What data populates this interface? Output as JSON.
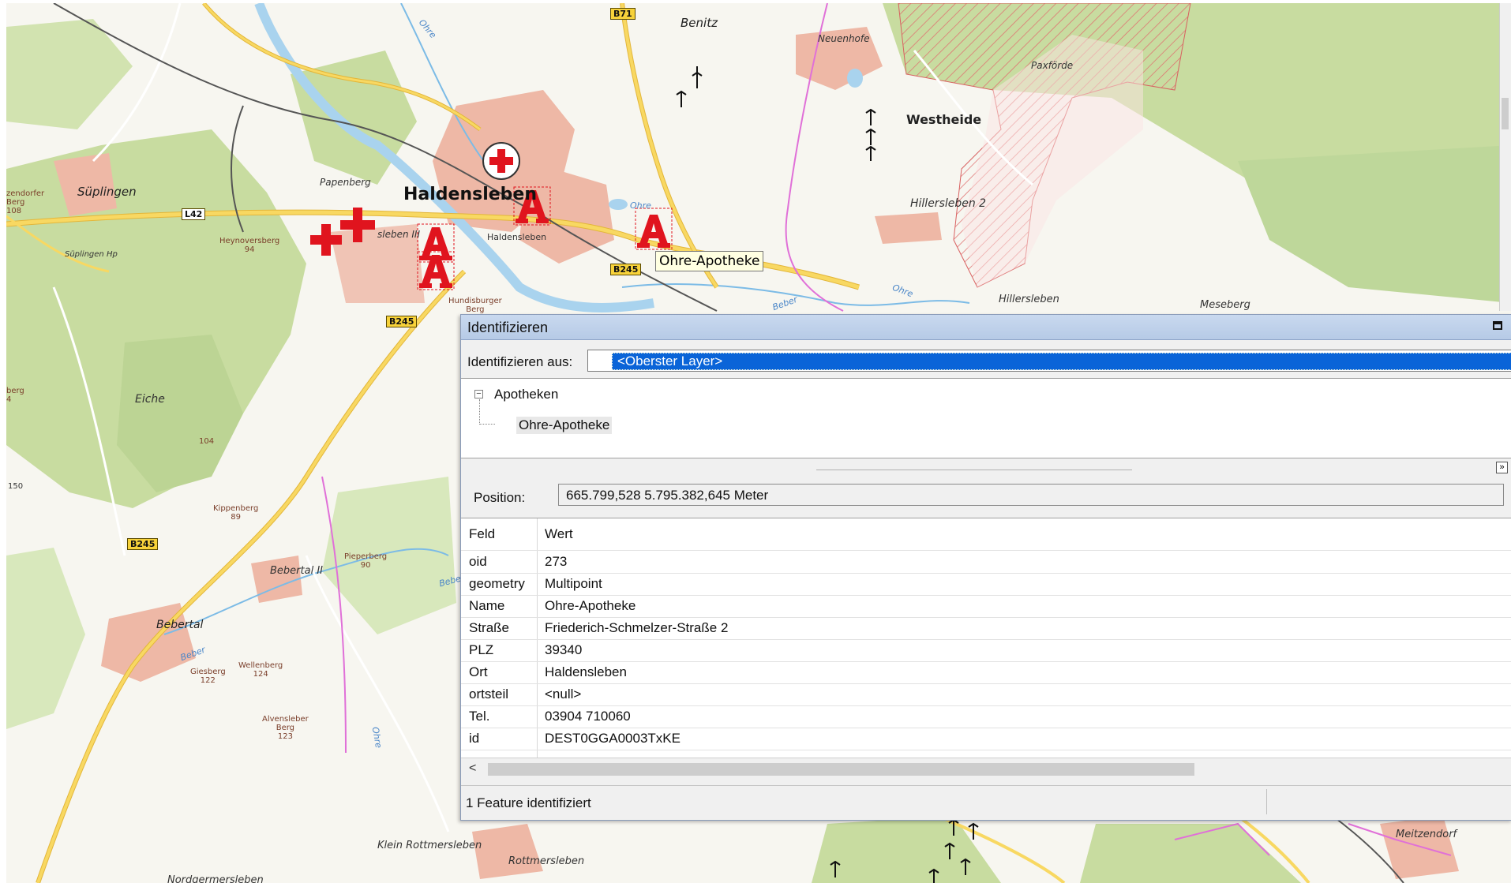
{
  "map": {
    "town_labels": {
      "haldensleben": "Haldensleben",
      "haldensleben_small": "Haldensleben",
      "haldensleben_iii": "sleben III",
      "suplingen": "Süplingen",
      "suplingen_hp": "Süplingen Hp",
      "papenberg": "Papenberg",
      "benitz": "Benitz",
      "neuenhofe": "Neuenhofe",
      "paxforde": "Paxförde",
      "westheide": "Westheide",
      "hillersleben2": "Hillersleben 2",
      "hillersleben": "Hillersleben",
      "meseberg": "Meseberg",
      "eiche": "Eiche",
      "bebertal": "Bebertal",
      "bebertal2": "Bebertal II",
      "klein_rottmersleben": "Klein Rottmersleben",
      "rottmersleben": "Rottmersleben",
      "nordgermersleben": "Nordgermersleben",
      "meitzendorf": "Meitzendorf"
    },
    "hill_labels": {
      "heynoversberg": "Heynoversberg\n94",
      "hill104": "104",
      "kippenberg": "Kippenberg\n89",
      "pieperberg": "Pieperberg\n90",
      "giesberg": "Giesberg\n122",
      "wellenberg": "Wellenberg\n124",
      "alvenslebener_berg": "Alvensleber\nBerg\n123",
      "hundisburger": "Hundisburger\nBerg",
      "zendorfer": "zendorfer\nBerg\n108",
      "berg_left": "berg\n4",
      "h150": "150"
    },
    "water_labels": {
      "ohre1": "Ohre",
      "ohre2": "Ohre",
      "beber1": "Beber",
      "beber2": "Beber",
      "bebe": "Bebe",
      "ohre3": "Ohre",
      "ohre4": "Ohre"
    },
    "road_shields": {
      "b71": "B71",
      "l42": "L42",
      "b245_a": "B245",
      "b245_b": "B245",
      "b245_c": "B245"
    },
    "tooltip": "Ohre-Apotheke",
    "colors": {
      "forest": "#c8dca0",
      "settlement": "#eeb8a6",
      "water": "#a9d3ee",
      "road_major": "#f5c94c",
      "road_minor": "#ffffff",
      "admin_boundary": "#e070d8",
      "military": "#e58a8a",
      "pharmacy_red": "#e0141e"
    }
  },
  "identify": {
    "title": "Identifizieren",
    "from_label": "Identifizieren aus:",
    "layer_value": "<Oberster Layer>",
    "tree": {
      "parent": "Apotheken",
      "child": "Ohre-Apotheke",
      "toggle": "−"
    },
    "position_label": "Position:",
    "position_value": "665.799,528  5.795.382,645 Meter",
    "columns": {
      "field": "Feld",
      "value": "Wert"
    },
    "rows": [
      {
        "field": "oid",
        "value": "273"
      },
      {
        "field": "geometry",
        "value": "Multipoint"
      },
      {
        "field": "Name",
        "value": "Ohre-Apotheke"
      },
      {
        "field": "Straße",
        "value": "Friederich-Schmelzer-Straße 2"
      },
      {
        "field": "PLZ",
        "value": "39340"
      },
      {
        "field": "Ort",
        "value": "Haldensleben"
      },
      {
        "field": "ortsteil",
        "value": "<null>"
      },
      {
        "field": "Tel.",
        "value": "03904 710060"
      },
      {
        "field": "id",
        "value": "DEST0GGA0003TxKE"
      }
    ],
    "scroll_left_arrow": "<",
    "collapse_glyph": "»",
    "status": "1 Feature identifiziert"
  }
}
